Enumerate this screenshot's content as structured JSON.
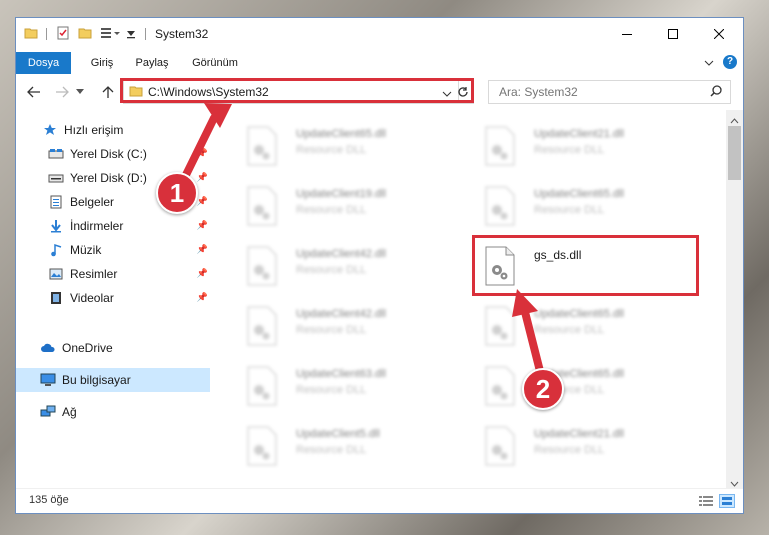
{
  "window": {
    "title": "System32"
  },
  "ribbon": {
    "tabs": [
      "Dosya",
      "Giriş",
      "Paylaş",
      "Görünüm"
    ]
  },
  "address": {
    "path": "C:\\Windows\\System32"
  },
  "search": {
    "placeholder": "Ara: System32"
  },
  "sidebar": {
    "items": [
      {
        "label": "Hızlı erişim",
        "icon": "star-icon"
      },
      {
        "label": "Yerel Disk (C:)",
        "icon": "drive-icon",
        "pinned": true
      },
      {
        "label": "Yerel Disk (D:)",
        "icon": "drive-icon",
        "pinned": true
      },
      {
        "label": "Belgeler",
        "icon": "documents-icon",
        "pinned": true
      },
      {
        "label": "İndirmeler",
        "icon": "download-icon",
        "pinned": true
      },
      {
        "label": "Müzik",
        "icon": "music-icon",
        "pinned": true
      },
      {
        "label": "Resimler",
        "icon": "pictures-icon",
        "pinned": true
      },
      {
        "label": "Videolar",
        "icon": "videos-icon",
        "pinned": true
      },
      {
        "label": "OneDrive",
        "icon": "cloud-icon"
      },
      {
        "label": "Bu bilgisayar",
        "icon": "computer-icon",
        "selected": true
      },
      {
        "label": "Ağ",
        "icon": "network-icon"
      }
    ]
  },
  "files": [
    {
      "name": "UpdateClient65.dll",
      "type": "Resource DLL",
      "blurred": true
    },
    {
      "name": "UpdateClient21.dll",
      "type": "Resource DLL",
      "blurred": true
    },
    {
      "name": "UpdateClient19.dll",
      "type": "Resource DLL",
      "blurred": true
    },
    {
      "name": "UpdateClient65.dll",
      "type": "Resource DLL",
      "blurred": true
    },
    {
      "name": "UpdateClient42.dll",
      "type": "Resource DLL",
      "blurred": true
    },
    {
      "name": "gs_ds.dll",
      "type": "",
      "blurred": false
    },
    {
      "name": "UpdateClient42.dll",
      "type": "Resource DLL",
      "blurred": true
    },
    {
      "name": "UpdateClient65.dll",
      "type": "Resource DLL",
      "blurred": true
    },
    {
      "name": "UpdateClient63.dll",
      "type": "Resource DLL",
      "blurred": true
    },
    {
      "name": "UpdateClient65.dll",
      "type": "Resource DLL",
      "blurred": true
    },
    {
      "name": "UpdateClient5.dll",
      "type": "Resource DLL",
      "blurred": true
    },
    {
      "name": "UpdateClient21.dll",
      "type": "Resource DLL",
      "blurred": true
    }
  ],
  "status": {
    "count": "135 öğe"
  },
  "annotations": {
    "step1": "1",
    "step2": "2"
  },
  "colors": {
    "accent": "#1979ca",
    "highlight": "#d9303a",
    "selected": "#cce8ff"
  }
}
